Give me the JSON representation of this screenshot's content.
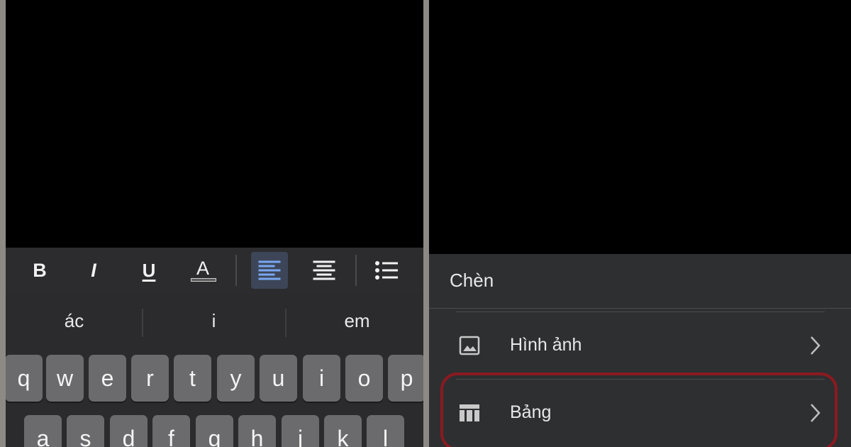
{
  "toolbar": {
    "bold_label": "B",
    "italic_label": "I",
    "underline_label": "U",
    "text_color_label": "A"
  },
  "keyboard": {
    "suggestions": [
      "ác",
      "i",
      "em"
    ],
    "row1": [
      "q",
      "w",
      "e",
      "r",
      "t",
      "y",
      "u",
      "i",
      "o",
      "p"
    ],
    "row2": [
      "a",
      "s",
      "d",
      "f",
      "g",
      "h",
      "j",
      "k",
      "l"
    ]
  },
  "insert_menu": {
    "title": "Chèn",
    "items": [
      {
        "label": "Hình ảnh",
        "icon": "image-icon"
      },
      {
        "label": "Bảng",
        "icon": "table-icon",
        "highlighted": true
      }
    ]
  },
  "colors": {
    "accent": "#7aa7f0",
    "highlight_ring": "#8b1a20",
    "sheet_bg": "#2e2f31",
    "keyboard_bg": "#2b2b2d"
  }
}
